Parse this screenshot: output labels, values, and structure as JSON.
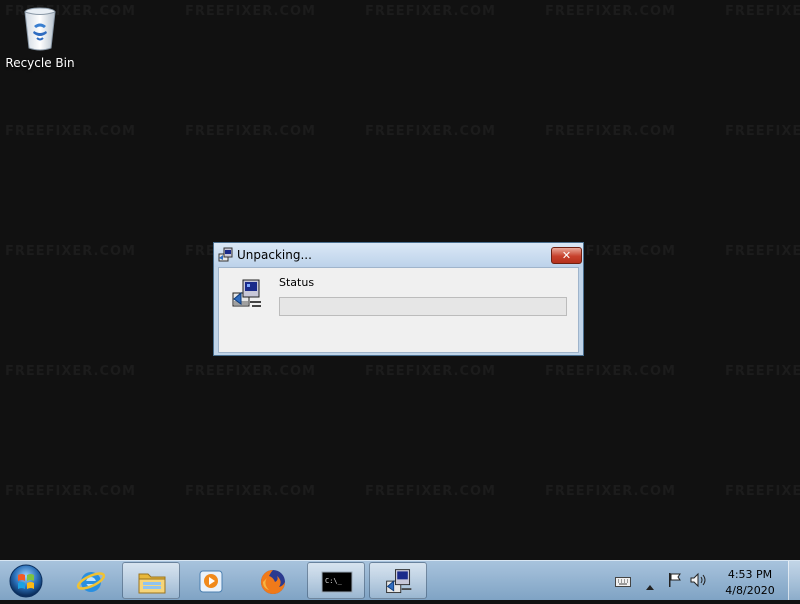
{
  "desktop": {
    "watermark_text": "FREEFIXER.COM",
    "icons": [
      {
        "label": "Recycle Bin",
        "icon": "recycle-bin-icon"
      }
    ]
  },
  "dialog": {
    "title": "Unpacking...",
    "close_label": "✕",
    "status_label": "Status",
    "progress": 0,
    "icons": {
      "title": "installer-icon",
      "main": "installer-icon"
    }
  },
  "taskbar": {
    "start_icon": "windows-start-orb",
    "pinned": [
      {
        "name": "internet-explorer",
        "icon": "internet-explorer-icon",
        "active": false
      },
      {
        "name": "file-explorer",
        "icon": "folder-icon",
        "active": true
      },
      {
        "name": "media-player",
        "icon": "media-player-icon",
        "active": false
      },
      {
        "name": "firefox",
        "icon": "firefox-icon",
        "active": false
      },
      {
        "name": "command-prompt",
        "icon": "command-prompt-icon",
        "active": true,
        "glyph": "C:\\_"
      },
      {
        "name": "installer",
        "icon": "installer-icon",
        "active": true
      }
    ],
    "tray": {
      "icons": [
        "keyboard-icon",
        "show-hidden-icons-arrow",
        "action-center-flag-icon",
        "volume-icon"
      ],
      "time": "4:53 PM",
      "date": "4/8/2020"
    }
  },
  "colors": {
    "desktop_bg": "#111111",
    "taskbar": "#a8c3dd",
    "close_button": "#c7412c",
    "progress_fill": "#06b025"
  }
}
